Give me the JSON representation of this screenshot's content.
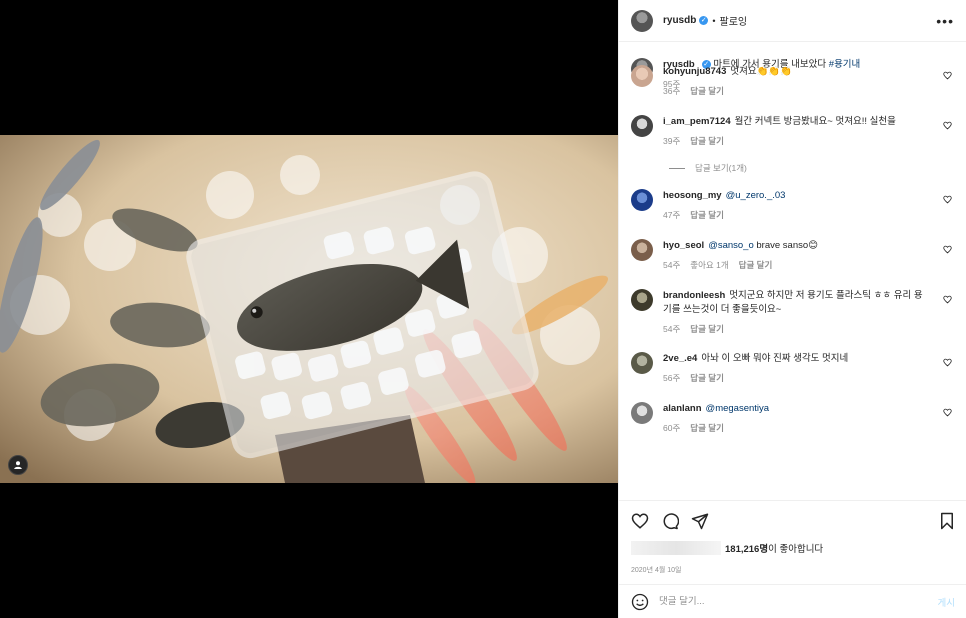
{
  "header": {
    "username": "ryusdb",
    "dot": "•",
    "follow_label": "팔로잉",
    "more": "•••"
  },
  "caption": {
    "username": "ryusdb",
    "text": "마트에 가서 용기를 내보았다",
    "hashtag": "#용기내",
    "age": "95주"
  },
  "reply_label": "답글 달기",
  "comments": [
    {
      "username": "kohyunju8743",
      "text": "멋져요",
      "emoji": "👏👏👏",
      "age": "36주"
    },
    {
      "username": "i_am_pem7124",
      "text": "월간 커넥트 방금봤내요~ 멋져요!! 실천을",
      "age": "39주"
    },
    {
      "username": "heosong_my",
      "mention": "@u_zero._.03",
      "text": "",
      "age": "47주"
    },
    {
      "username": "hyo_seol",
      "mention": "@sanso_o",
      "text": " brave sanso",
      "emoji": "😊",
      "age": "54주",
      "likes": "좋아요 1개"
    },
    {
      "username": "brandonleesh",
      "text": "멋지군요 하지만 저 용기도 플라스틱 ㅎㅎ 유리 용기를 쓰는것이 더 좋을듯이요~",
      "age": "54주"
    },
    {
      "username": "2ve_.e4",
      "text": "아놔 이 오빠 뭐야 진짜 생각도 멋지네",
      "age": "56주"
    },
    {
      "username": "alanlann",
      "mention": "@megasentiya",
      "text": "",
      "age": "60주"
    }
  ],
  "view_replies": "답글 보기(1개)",
  "likes": {
    "count": "181,216명",
    "suffix": "이 좋아합니다"
  },
  "date": "2020년 4월 10일",
  "compose": {
    "placeholder": "댓글 달기...",
    "post": "게시"
  },
  "colors": {
    "link": "#00376b",
    "verified": "#3897f0",
    "post_disabled": "#b2dffc"
  }
}
